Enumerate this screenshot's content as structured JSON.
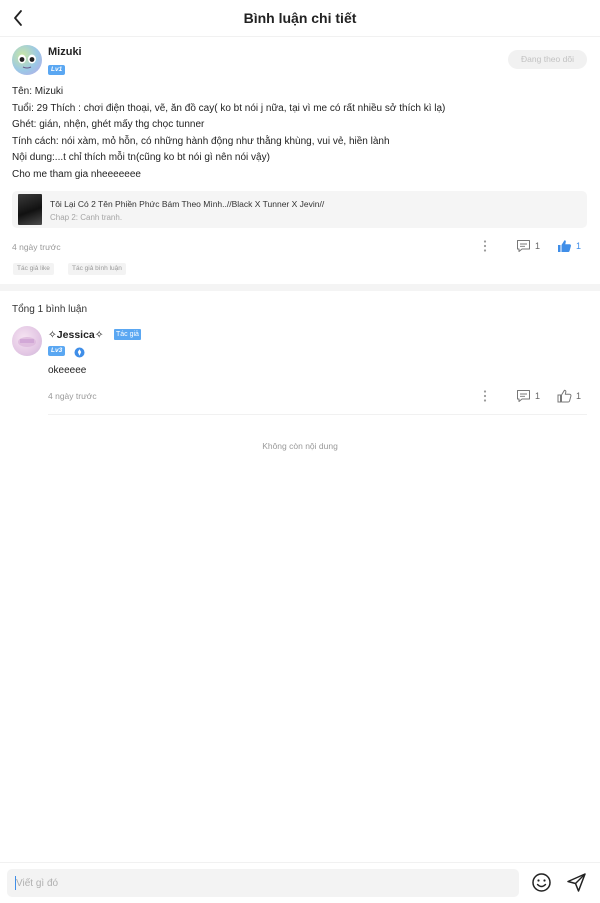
{
  "header": {
    "title": "Bình luận chi tiết"
  },
  "post": {
    "username": "Mizuki",
    "level": "Lv1",
    "follow_label": "Đang theo dõi",
    "lines": [
      "Tên: Mizuki",
      " Tuổi: 29 Thích : chơi điện thoại, vẽ, ăn đồ cay( ko bt nói j nữa, tại vì me có rất nhiều sở thích kì lạ)",
      "Ghét: gián, nhện, ghét mấy thg chọc tunner",
      " Tính cách: nói xàm, mỏ hỗn, có những hành động như thằng khùng, vui vẻ, hiền lành",
      "Nội dung:...t chỉ thích mỗi tn(cũng ko bt nói gì nên nói vậy)",
      "Cho me tham gia nheeeeeee"
    ],
    "story": {
      "title": "Tôi Lại Có 2 Tên Phiền Phức Bám Theo Mình..//Black X Tunner X Jevin//",
      "chapter": "Chap 2: Canh tranh."
    },
    "time": "4 ngày trước",
    "comment_count": "1",
    "like_count": "1",
    "tags": [
      "Tác giả like",
      "Tác giả bình luận"
    ]
  },
  "comments_section": {
    "total_label": "Tổng 1 bình luận",
    "reply": {
      "username": "✧Jessica✧",
      "author_badge": "Tác giả",
      "level": "Lv3",
      "text": "okeeeee",
      "time": "4 ngày trước",
      "comment_count": "1",
      "like_count": "1"
    },
    "end_label": "Không còn nội dung"
  },
  "composer": {
    "placeholder": "Viết gì đó"
  },
  "colors": {
    "accent": "#3f8ee8",
    "badge": "#5aa7f2"
  },
  "icons": [
    "back-arrow-icon",
    "more-vertical-icon",
    "comment-icon",
    "thumbs-up-icon",
    "verified-icon",
    "emoji-icon",
    "send-icon"
  ]
}
